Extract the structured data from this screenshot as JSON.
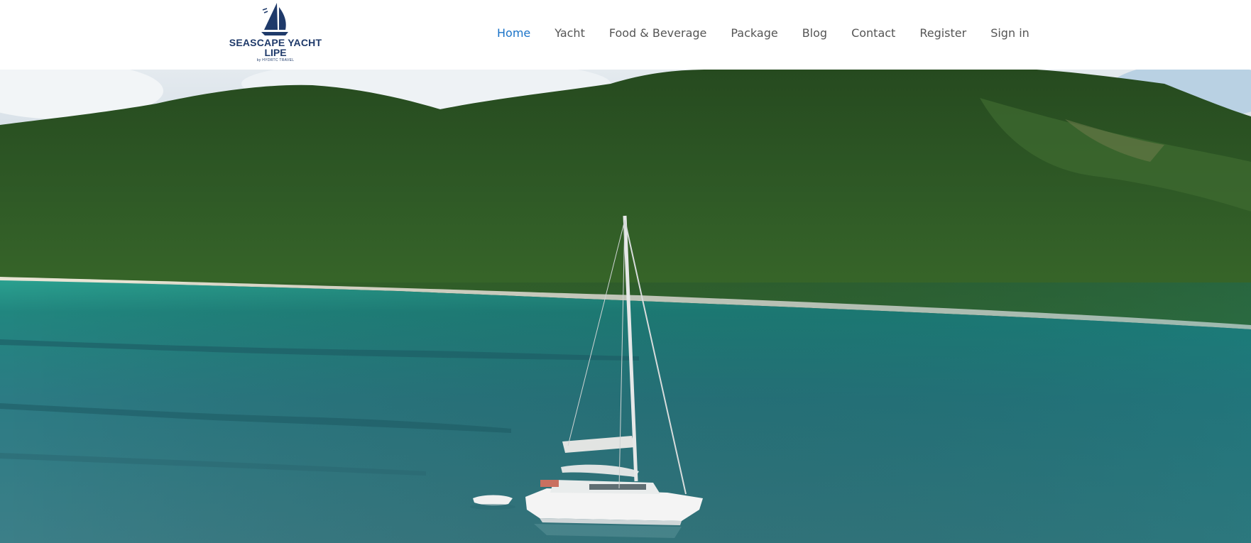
{
  "brand": {
    "name_line1": "SEASCAPE YACHT",
    "name_line2": "LIPE",
    "tagline": "by HYDRTC TRAVEL",
    "icon": "sailboat-logo-icon",
    "color": "#1f3a6a"
  },
  "nav": {
    "active_color": "#1a73c8",
    "items": [
      {
        "label": "Home",
        "active": true
      },
      {
        "label": "Yacht",
        "active": false
      },
      {
        "label": "Food & Beverage",
        "active": false
      },
      {
        "label": "Package",
        "active": false
      },
      {
        "label": "Blog",
        "active": false
      },
      {
        "label": "Contact",
        "active": false
      },
      {
        "label": "Register",
        "active": false
      },
      {
        "label": "Sign in",
        "active": false
      }
    ]
  },
  "hero": {
    "image": "aerial-catamaran-island-photo",
    "sea_color": "#2f7f86",
    "forest_color": "#2f5a26"
  }
}
